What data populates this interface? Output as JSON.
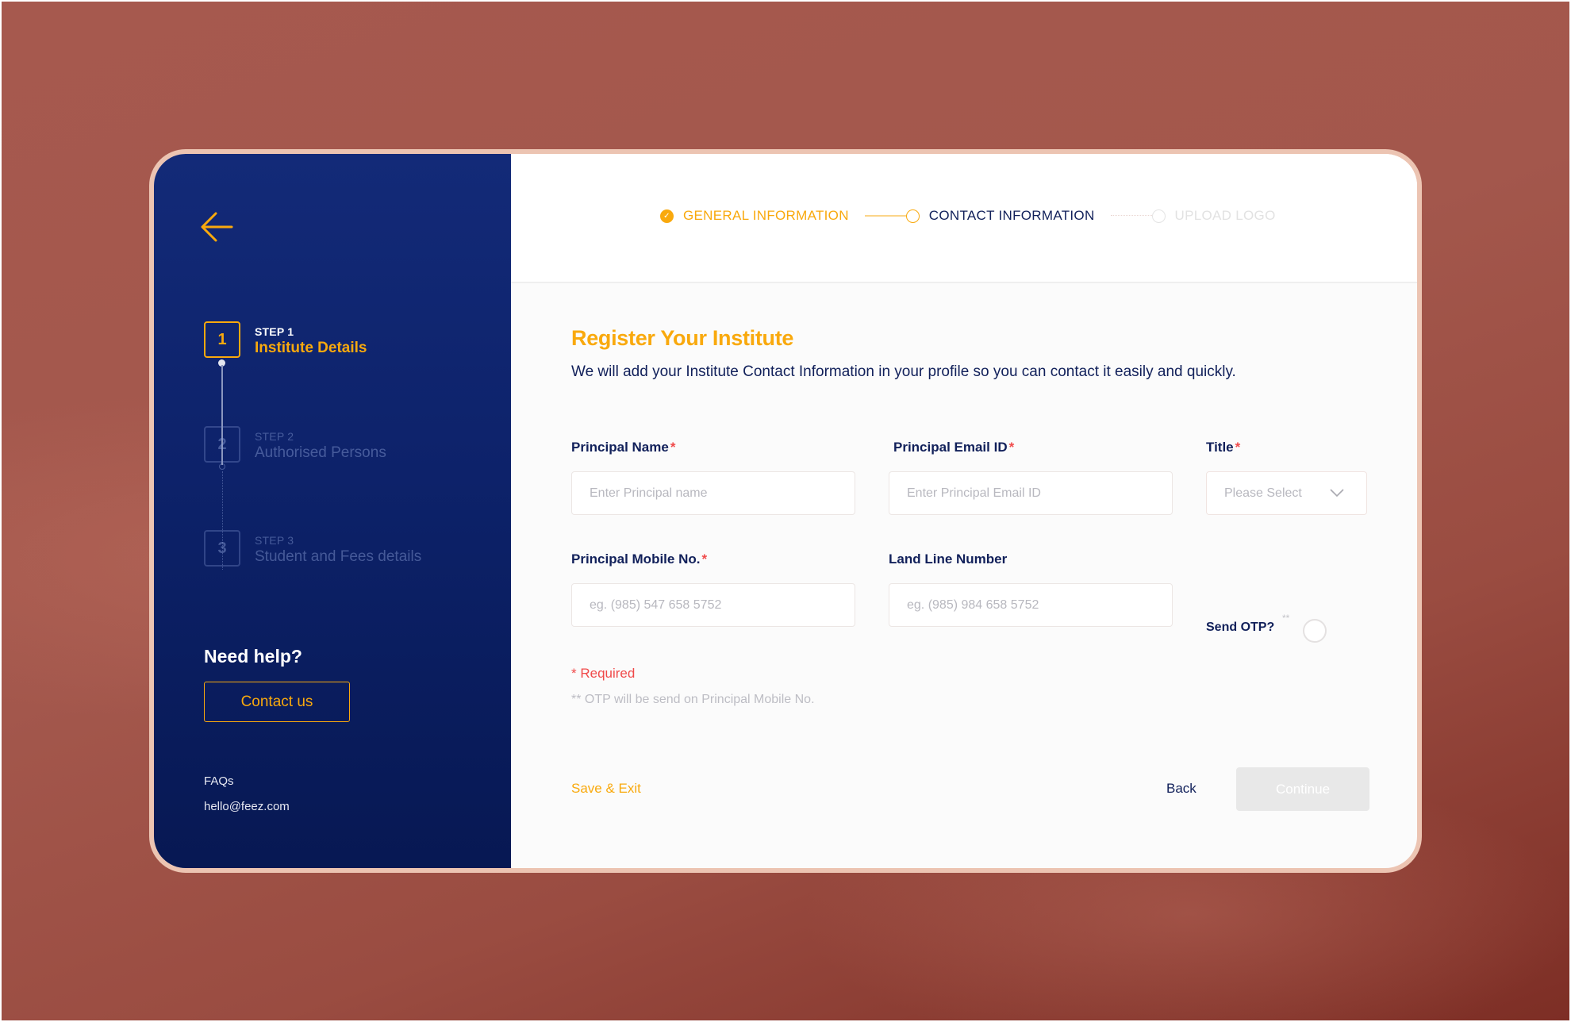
{
  "sidebar": {
    "back_icon": "arrow-left-icon",
    "steps": [
      {
        "number": "1",
        "step_label": "STEP 1",
        "title": "Institute Details",
        "state": "active"
      },
      {
        "number": "2",
        "step_label": "STEP 2",
        "title": "Authorised Persons",
        "state": "inactive"
      },
      {
        "number": "3",
        "step_label": "STEP 3",
        "title": "Student and Fees details",
        "state": "inactive"
      }
    ],
    "help_title": "Need help?",
    "contact_button": "Contact us",
    "faq_link": "FAQs",
    "email_link": "hello@feez.com"
  },
  "progress": {
    "items": [
      {
        "label": "GENERAL INFORMATION",
        "state": "done",
        "icon": "check-icon"
      },
      {
        "label": "CONTACT INFORMATION",
        "state": "current"
      },
      {
        "label": "UPLOAD LOGO",
        "state": "pending"
      }
    ]
  },
  "form": {
    "title": "Register Your Institute",
    "subtitle": "We will add your Institute Contact Information in your profile so you can contact it easily and quickly.",
    "required_mark": "*",
    "fields": {
      "principal_name": {
        "label": "Principal Name",
        "placeholder": "Enter Principal name",
        "value": "",
        "required": true
      },
      "principal_email": {
        "label": "Principal Email ID",
        "placeholder": "Enter Principal Email ID",
        "value": "",
        "required": true
      },
      "title": {
        "label": "Title",
        "selected": "Please Select",
        "required": true
      },
      "principal_mobile": {
        "label": "Principal Mobile No.",
        "placeholder": "eg. (985) 547 658 5752",
        "value": "",
        "required": true
      },
      "land_line": {
        "label": "Land Line Number",
        "placeholder": "eg. (985) 984 658 5752",
        "value": "",
        "required": false
      }
    },
    "send_otp": {
      "label": "Send OTP?",
      "footnote_mark": "**",
      "checked": false
    },
    "notes": {
      "required": "* Required",
      "otp": "** OTP will be send on Principal Mobile No."
    },
    "actions": {
      "save_exit": "Save & Exit",
      "back": "Back",
      "continue": "Continue",
      "continue_disabled": true
    }
  },
  "colors": {
    "accent": "#f9a90d",
    "navy": "#11205a",
    "sidebar": "#0d226a",
    "error": "#f04a4a",
    "background": "#a3574c",
    "card_border": "#ecc4b2"
  }
}
